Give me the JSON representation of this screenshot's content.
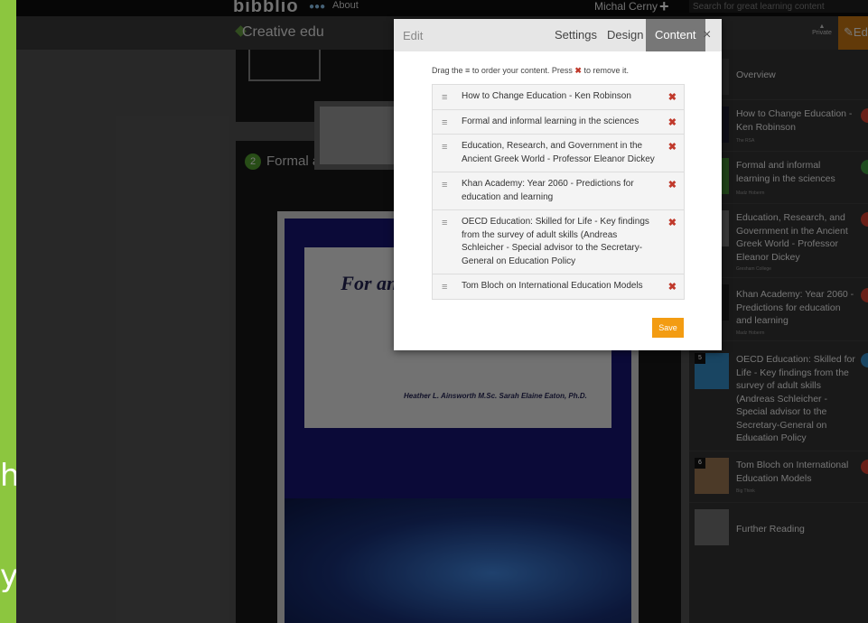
{
  "header": {
    "logo": "bibblio",
    "about_dots": "●●●",
    "about": "About",
    "username": "Michal Cerny",
    "search_placeholder": "Search for great learning content"
  },
  "subbar": {
    "collection_title": "Creative edu",
    "private_label": "Private",
    "edit_label": "Ed"
  },
  "main": {
    "card2_number": "2",
    "card2_title": "Formal a",
    "doc_title": "For and i in",
    "doc_authors": "Heather L. Ainsworth M.Sc. Sarah Elaine Eaton, Ph.D."
  },
  "slide_chars": [
    "h",
    "y"
  ],
  "sidebar": {
    "overview": "Overview",
    "items": [
      {
        "num": "",
        "title": "How to Change Education - Ken Robinson",
        "source": "The RSA"
      },
      {
        "num": "",
        "title": "Formal and informal learning in the sciences",
        "source": "Madz Hoberm"
      },
      {
        "num": "",
        "title": "Education, Research, and Government in the Ancient Greek World - Professor Eleanor Dickey",
        "source": "Gresham College"
      },
      {
        "num": "",
        "title": "Khan Academy: Year 2060 - Predictions for education and learning",
        "source": "Madz Hoberm"
      },
      {
        "num": "5",
        "title": "OECD Education: Skilled for Life - Key findings from the survey of adult skills (Andreas Schleicher - Special advisor to the Secretary-General on Education Policy",
        "source": "Best of Slideshare"
      },
      {
        "num": "6",
        "title": "Tom Bloch on International Education Models",
        "source": "Big Think"
      }
    ],
    "further_reading": "Further Reading"
  },
  "modal": {
    "edit_label": "Edit",
    "tabs": [
      "Settings",
      "Design",
      "Content"
    ],
    "active_tab": "Content",
    "close": "×",
    "help_prefix": "Drag the",
    "help_middle": "to order your content. Press",
    "help_suffix": "to remove it.",
    "drag_glyph": "≡",
    "remove_glyph": "✖",
    "items": [
      "How to Change Education - Ken Robinson",
      "Formal and informal learning in the sciences",
      "Education, Research, and Government in the Ancient Greek World - Professor Eleanor Dickey",
      "Khan Academy: Year 2060 - Predictions for education and learning",
      "OECD Education: Skilled for Life - Key findings from the survey of adult skills (Andreas Schleicher - Special advisor to the Secretary-General on Education Policy",
      "Tom Bloch on International Education Models"
    ],
    "save_label": "Save"
  },
  "colors": {
    "accent_orange": "#f39c12",
    "remove_red": "#c0392b",
    "slide_green": "#8cc63f"
  },
  "icons": [
    "plus-icon",
    "search-icon",
    "lock-icon",
    "pencil-icon",
    "drag-handle-icon",
    "remove-icon",
    "close-icon"
  ]
}
